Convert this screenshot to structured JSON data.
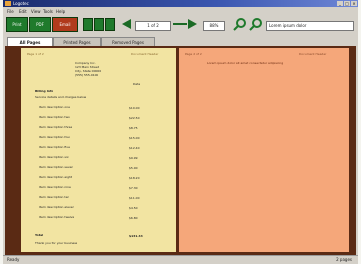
{
  "window": {
    "title": "Logotec"
  },
  "menu": [
    "File",
    "Edit",
    "View",
    "Tools",
    "Help"
  ],
  "toolbar": {
    "print_label": "Print",
    "pdf_label": "PDF",
    "email_label": "Email",
    "page_value": "1 of 2",
    "zoom_value": "88%",
    "search_placeholder": "Lorem ipsum dolor"
  },
  "tabs": [
    "All Pages",
    "Printed Pages",
    "Removed Pages"
  ],
  "colors": {
    "accent_green": "#1f7a2c",
    "printed_page": "#f2e4a2",
    "removed_page": "#f5a77a",
    "background": "#5a2a14"
  },
  "document_left": {
    "header_left": "Page 1 of 2",
    "header_right": "Document Header",
    "address": [
      "Company Inc.",
      "123 Main Street",
      "City, State 00000",
      "(555) 555-0100"
    ],
    "date_label": "Date",
    "greeting": "Billing Info",
    "intro": "Service details and charges below",
    "items": [
      {
        "text": "Item description one",
        "price": "$10.00"
      },
      {
        "text": "Item description two",
        "price": "$22.50"
      },
      {
        "text": "Item description three",
        "price": "$8.75"
      },
      {
        "text": "Item description four",
        "price": "$15.00"
      },
      {
        "text": "Item description five",
        "price": "$12.40"
      },
      {
        "text": "Item description six",
        "price": "$9.99"
      },
      {
        "text": "Item description seven",
        "price": "$5.00"
      },
      {
        "text": "Item description eight",
        "price": "$18.20"
      },
      {
        "text": "Item description nine",
        "price": "$7.30"
      },
      {
        "text": "Item description ten",
        "price": "$11.00"
      },
      {
        "text": "Item description eleven",
        "price": "$4.50"
      },
      {
        "text": "Item description twelve",
        "price": "$6.80"
      }
    ],
    "total_label": "Total",
    "total_value": "$131.44",
    "footer": "Thank you for your business"
  },
  "document_right": {
    "header_left": "Page 2 of 2",
    "header_right": "Document Header",
    "line": "Lorem ipsum dolor sit amet consectetur adipiscing"
  },
  "status": {
    "left": "Ready",
    "right": "2 pages"
  }
}
